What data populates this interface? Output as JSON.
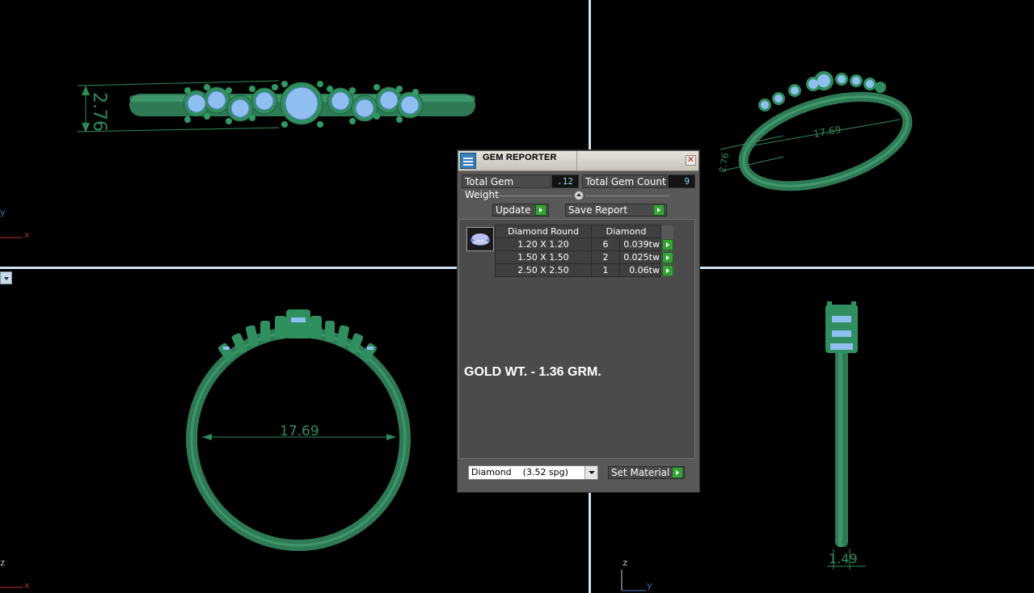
{
  "viewports": {
    "top": {
      "dimension": "2.76",
      "axes": [
        "y",
        "x"
      ]
    },
    "perspective": {
      "dimension_ring": "17.69",
      "dimension_side": "2.76"
    },
    "front": {
      "dimension": "17.69",
      "axes": [
        "z",
        "x"
      ]
    },
    "right": {
      "dimension": "1.49",
      "axes": [
        "z",
        "y"
      ]
    }
  },
  "colors": {
    "ring_green": "#2e8a5a",
    "gem_blue": "#8fbff0",
    "splitter": "#cfe2ee",
    "panel_bg": "#585858",
    "go_button": "#37a237"
  },
  "gem_reporter": {
    "title": "GEM REPORTER",
    "close_icon": "close-icon",
    "total_gem_weight_label": "Total Gem Weight",
    "total_gem_weight_value": ".12",
    "total_gem_count_label": "Total Gem Count",
    "total_gem_count_value": "9",
    "update_label": "Update",
    "save_report_label": "Save Report",
    "table": {
      "headers": [
        "Diamond Round",
        "Diamond"
      ],
      "rows": [
        {
          "size": "1.20 X 1.20",
          "count": "6",
          "weight": "0.039tw"
        },
        {
          "size": "1.50 X 1.50",
          "count": "2",
          "weight": "0.025tw"
        },
        {
          "size": "2.50 X 2.50",
          "count": "1",
          "weight": "0.06tw"
        }
      ]
    },
    "note": "GOLD WT. - 1.36 GRM.",
    "material_selected": "Diamond    (3.52 spg)",
    "set_material_label": "Set Material"
  }
}
